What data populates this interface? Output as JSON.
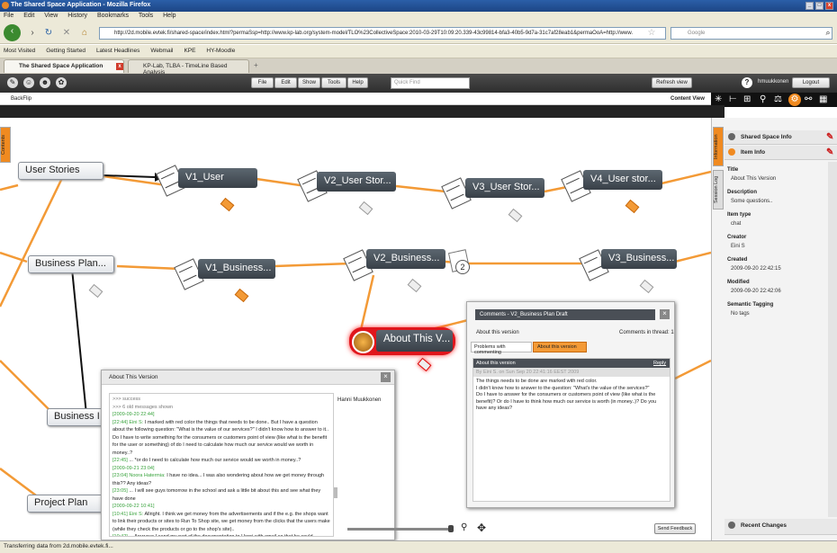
{
  "window": {
    "title": "The Shared Space Application - Mozilla Firefox"
  },
  "menu": [
    "File",
    "Edit",
    "View",
    "History",
    "Bookmarks",
    "Tools",
    "Help"
  ],
  "nav": {
    "url": "http://2d.mobile.evtek.fi/shared-space/index.html?permaSsp=http://www.kp-lab.org/system-model/TLO%23CollectiveSpace:2010-03-29T10:09:20.339-43c99814-bfa3-40b5-9d7a-31c7af28eab1&permaOoA=http://www.",
    "search_placeholder": "Google"
  },
  "bookmarks": [
    "Most Visited",
    "Getting Started",
    "Latest Headlines",
    "Webmail",
    "KPE",
    "HY-Moodle"
  ],
  "tabs": [
    {
      "label": "The Shared Space Application"
    },
    {
      "label": "KP-Lab, TLBA - TimeLine Based Analysis"
    }
  ],
  "app_menu": [
    "File",
    "Edit",
    "Show",
    "Tools",
    "Help"
  ],
  "quick_find_placeholder": "Quick Find",
  "refresh_label": "Refresh view",
  "user": "hmuukkonen",
  "logout_label": "Logout",
  "subbar": {
    "left": "BackFlip",
    "right": "Content View"
  },
  "left_tab": "Contents",
  "nodes": {
    "user_stories": "User Stories",
    "v1_user": "V1_User",
    "v2_user": "V2_User Stor...",
    "v3_user": "V3_User Stor...",
    "v4_user": "V4_User stor...",
    "business_plan": "Business Plan...",
    "v1_business": "V1_Business...",
    "v2_business": "V2_Business...",
    "v3_business": "V3_Business...",
    "about": "About This V...",
    "business_lower": "Business I",
    "project_plan": "Project Plan",
    "badge_count": "2"
  },
  "about_panel": {
    "title": "About This Version",
    "user": "Hanni Muukkonen",
    "lines": [
      {
        "t": ">>> success",
        "c": "g"
      },
      {
        "t": ">>> 6 old messages shown",
        "c": "g"
      },
      {
        "t": "[2009-09-20 22:44]",
        "c": "ts"
      },
      {
        "t": "[22:44] Eini S:",
        "c": "ts",
        "rest": " I marked with red color the things that needs to be done.. But I have a question about the following question: \"What is the value of our services?\" I didn't know how to answer to it.. Do I have to write something for the consumers or customers point of view (like what is the benefit for the user or something) of do I need to calculate how much our service would we worth in money..?"
      },
      {
        "t": "[22:45]",
        "c": "ts",
        "rest": " ... *or do I need to calculate how much our service would we worth in money..?"
      },
      {
        "t": "[2009-09-21 23:04]",
        "c": "ts"
      },
      {
        "t": "[23:04] Noora Hatermia:",
        "c": "ts",
        "rest": " I have no idea... I was also wondering about how we get money through this?? Any ideas?"
      },
      {
        "t": "[23:05]",
        "c": "ts",
        "rest": " ... I will see guys tomorrow in the school and ask a little bit about this and see what they have done"
      },
      {
        "t": "[2009-09-22 10:41]",
        "c": "ts"
      },
      {
        "t": "[10:41] Eini S:",
        "c": "ts",
        "rest": " Allright. I think we get money from the advertisements and if the e.g. the shops want to link their products or sites to Run To Shop site, we get money from the clicks that the users make (while they check the products or go to the shop's site).."
      },
      {
        "t": "[10:42]",
        "c": "ts",
        "rest": " ... Anyways I send my part of the documentation to Henri with email so that he could combine our documentation.. Thought I haven't still made any answer to the question.."
      }
    ]
  },
  "comments_panel": {
    "title": "Comments - V2_Business Plan Draft",
    "about_link": "About this version",
    "count_label": "Comments in thread: 1",
    "tab1": "Problems with commenting",
    "tab2": "About this version",
    "header": "About this version",
    "reply": "Reply",
    "byline": "By Eini S. on Sun Sep 20 22:41:16 EEST 2009",
    "body": "The things needs to be done are marked with red color.\nI didn't know how to answer to the question: \"What's the value of the services?\"\nDo I have to answer for the consumers or customers point of view (like what is the benefit)? Or do I have to think how much our service is worth (in money..)? Do you have any ideas?"
  },
  "send_feedback": "Send Feedback",
  "right_panel": {
    "vtab1": "Information",
    "vtab2": "Session Log",
    "shared_space_info": "Shared Space Info",
    "item_info": "Item Info",
    "fields": [
      {
        "label": "Title",
        "value": "About This Version"
      },
      {
        "label": "Description",
        "value": "Some questions.."
      },
      {
        "label": "Item type",
        "value": "chat"
      },
      {
        "label": "Creator",
        "value": "Eini S"
      },
      {
        "label": "Created",
        "value": "2009-09-20 22:42:15"
      },
      {
        "label": "Modified",
        "value": "2009-09-20 22:42:06"
      },
      {
        "label": "Semantic Tagging",
        "value": "No tags"
      }
    ],
    "recent_changes": "Recent Changes"
  },
  "status": "Transferring data from 2d.mobile.evtek.fi..."
}
